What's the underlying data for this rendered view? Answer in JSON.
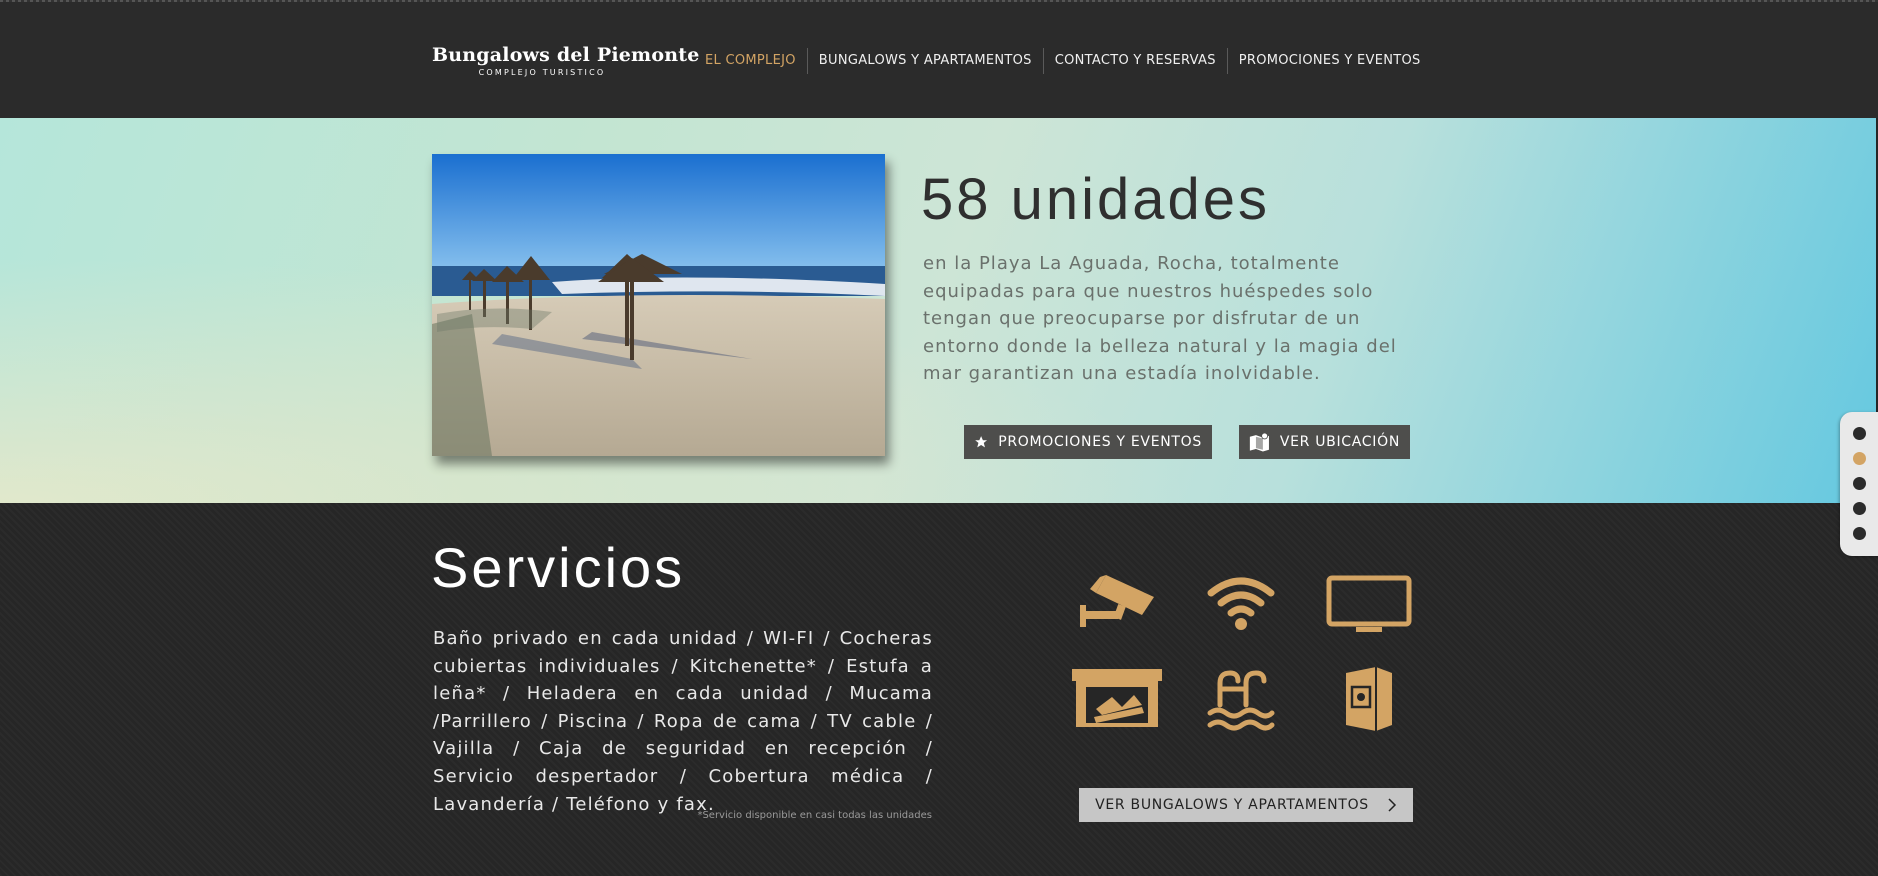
{
  "header": {
    "logo_title": "Bungalows del Piemonte",
    "logo_subtitle": "COMPLEJO TURISTICO",
    "nav": [
      {
        "label": "EL COMPLEJO",
        "active": true
      },
      {
        "label": "BUNGALOWS Y APARTAMENTOS",
        "active": false
      },
      {
        "label": "CONTACTO Y RESERVAS",
        "active": false
      },
      {
        "label": "PROMOCIONES Y EVENTOS",
        "active": false
      }
    ]
  },
  "hero": {
    "title": "58 unidades",
    "description": "en la Playa La Aguada, Rocha, totalmente equipadas para que nuestros huéspedes solo tengan que preocuparse por disfrutar de un entorno donde la belleza natural y la magia del mar garantizan una estadía inolvidable.",
    "buttons": {
      "promo": "PROMOCIONES Y EVENTOS",
      "location": "VER UBICACIÓN"
    },
    "icons": {
      "promo": "star-icon",
      "location": "map-icon"
    }
  },
  "page_nav": {
    "count": 5,
    "active_index": 1
  },
  "services": {
    "title": "Servicios",
    "description": "Baño privado en cada unidad / WI-FI / Cocheras cubiertas individuales / Kitchenette* / Estufa a leña* / Heladera en cada unidad / Mucama /Parrillero / Piscina / Ropa de cama / TV cable / Vajilla / Caja de seguridad en recepción / Servicio despertador / Cobertura médica / Lavandería / Teléfono y fax.",
    "footnote": "*Servicio disponible en casi todas las unidades",
    "icons": [
      "security-camera-icon",
      "wifi-icon",
      "tv-icon",
      "fireplace-icon",
      "pool-icon",
      "safe-icon"
    ],
    "button": "VER BUNGALOWS Y APARTAMENTOS"
  },
  "colors": {
    "accent": "#d3a464",
    "header_bg": "#2b2b2b",
    "dark_bg": "#262626",
    "button_dark": "#4e4e4c",
    "button_light": "#c6c6c6"
  }
}
